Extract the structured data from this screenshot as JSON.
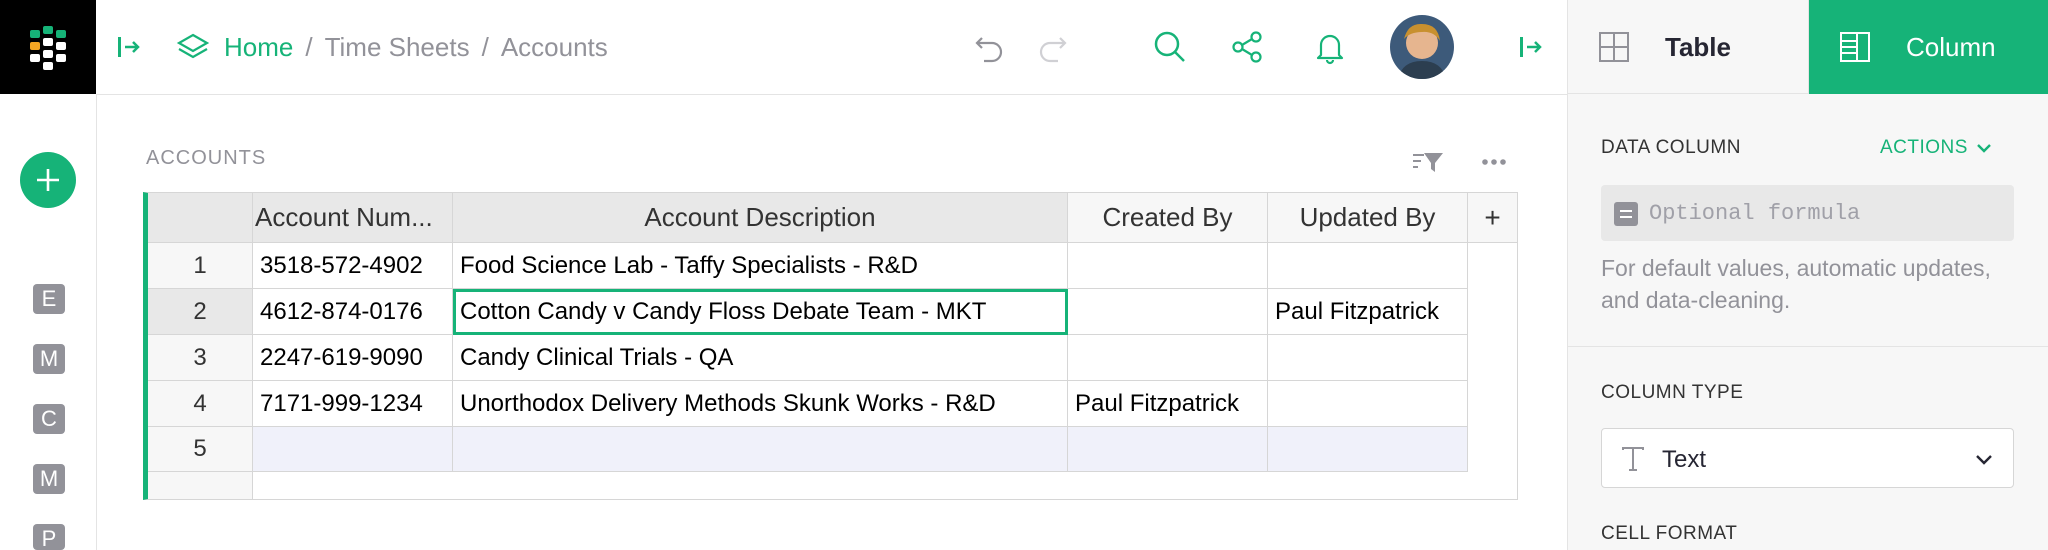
{
  "colors": {
    "accent": "#16b378",
    "muted": "#929299",
    "logo_bg": "#000000"
  },
  "breadcrumb": {
    "home": "Home",
    "doc": "Time Sheets",
    "page": "Accounts",
    "separator": "/"
  },
  "left_panel": {
    "pages": [
      "E",
      "M",
      "C",
      "M",
      "P"
    ]
  },
  "section": {
    "title": "ACCOUNTS"
  },
  "table": {
    "columns": [
      "Account Num...",
      "Account Description",
      "Created By",
      "Updated By"
    ],
    "add_column": "+",
    "rows": [
      {
        "num": "1",
        "account": "3518-572-4902",
        "description": "Food Science Lab - Taffy Specialists - R&D",
        "created_by": "",
        "updated_by": ""
      },
      {
        "num": "2",
        "account": "4612-874-0176",
        "description": "Cotton Candy v Candy Floss Debate Team - MKT",
        "created_by": "",
        "updated_by": "Paul Fitzpatrick"
      },
      {
        "num": "3",
        "account": "2247-619-9090",
        "description": "Candy Clinical Trials - QA",
        "created_by": "",
        "updated_by": ""
      },
      {
        "num": "4",
        "account": "7171-999-1234",
        "description": "Unorthodox Delivery Methods Skunk Works - R&D",
        "created_by": "Paul Fitzpatrick",
        "updated_by": ""
      }
    ],
    "new_row_num": "5"
  },
  "right_panel": {
    "tab_table": "Table",
    "tab_column": "Column",
    "data_column_label": "DATA COLUMN",
    "actions_label": "ACTIONS",
    "formula_placeholder": "Optional formula",
    "hint": "For default values, automatic updates, and data-cleaning.",
    "column_type_label": "COLUMN TYPE",
    "column_type_value": "Text",
    "cell_format_label": "CELL FORMAT"
  }
}
